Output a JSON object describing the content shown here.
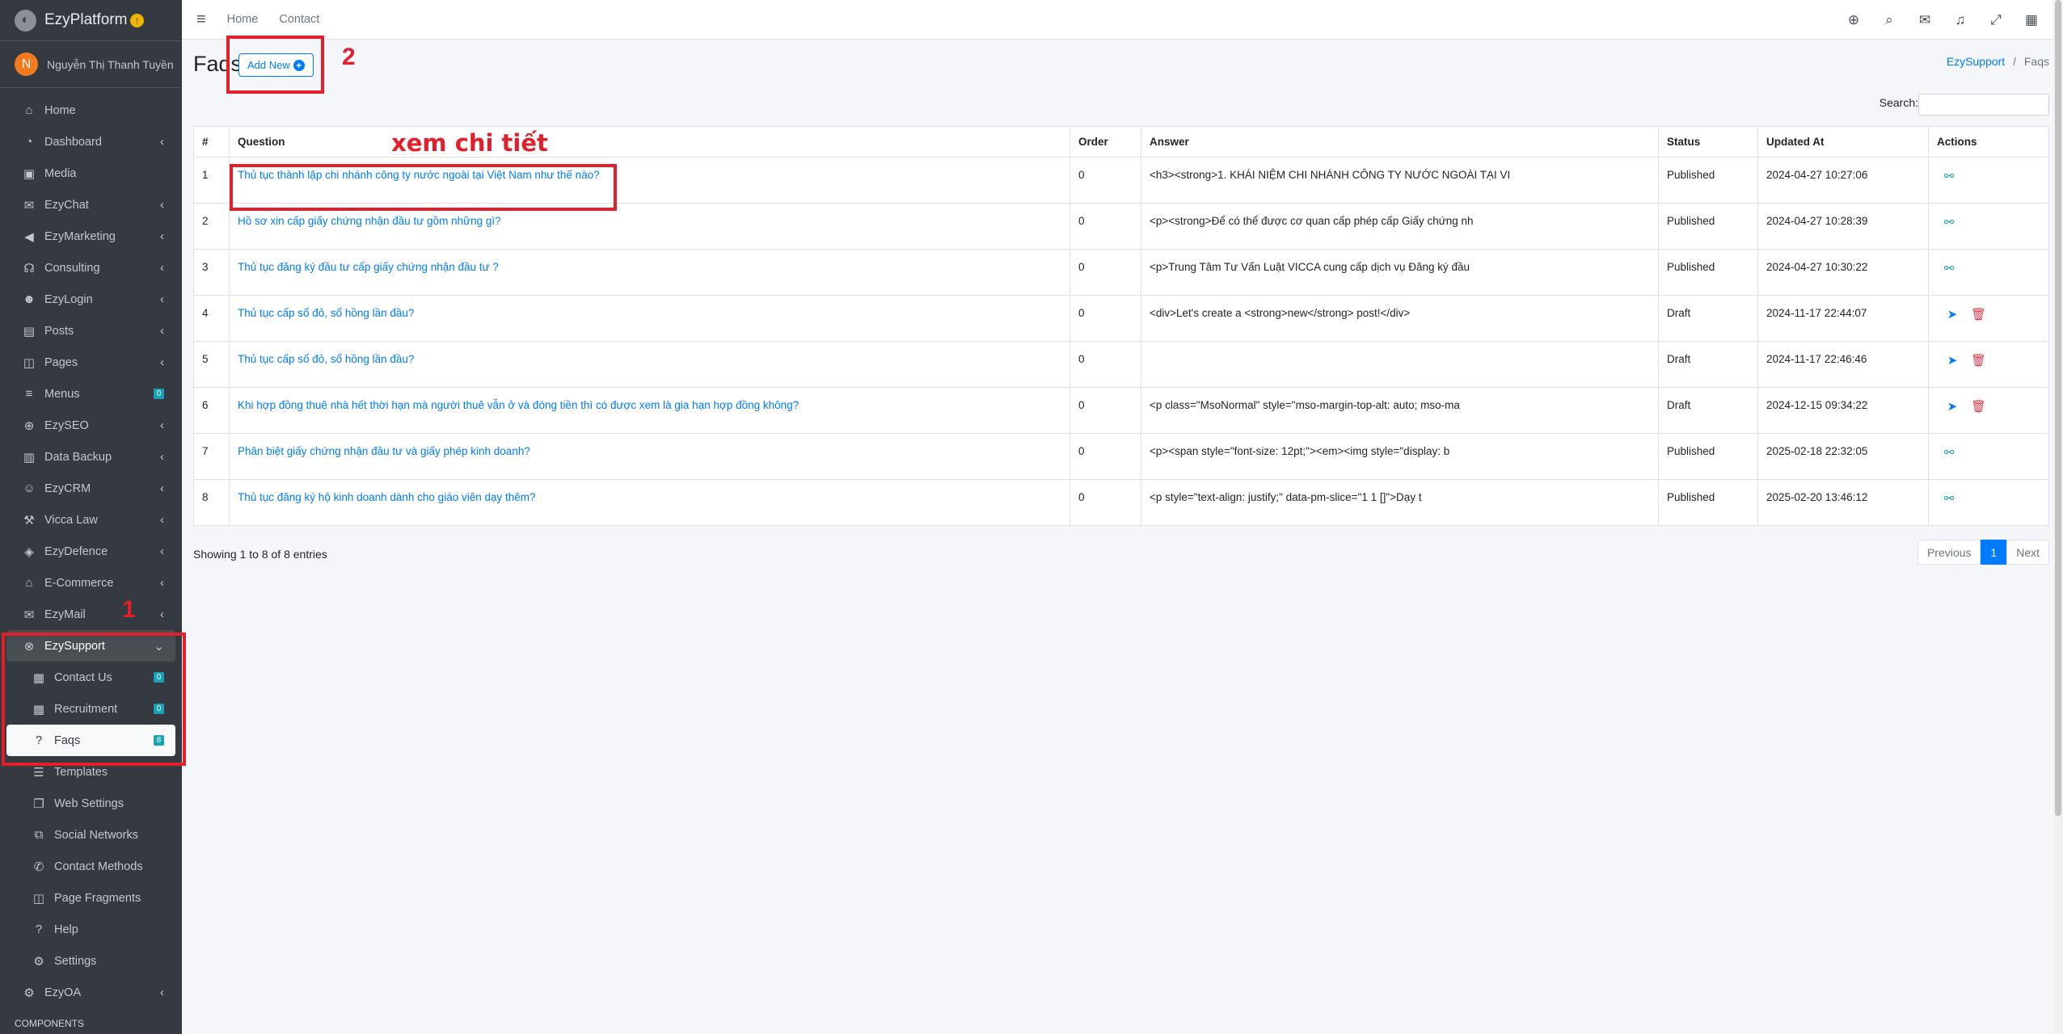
{
  "brand": {
    "name": "EzyPlatform",
    "up_icon": "arrow-up-circle-icon"
  },
  "user": {
    "initial": "N",
    "name": "Nguyễn Thị Thanh Tuyền"
  },
  "sidebar": {
    "items": [
      {
        "label": "Home",
        "icon": "home-icon",
        "arrow": false
      },
      {
        "label": "Dashboard",
        "icon": "dashboard-icon",
        "arrow": true
      },
      {
        "label": "Media",
        "icon": "image-icon",
        "arrow": false
      },
      {
        "label": "EzyChat",
        "icon": "chat-icon",
        "arrow": true
      },
      {
        "label": "EzyMarketing",
        "icon": "megaphone-icon",
        "arrow": true
      },
      {
        "label": "Consulting",
        "icon": "headset-icon",
        "arrow": true
      },
      {
        "label": "EzyLogin",
        "icon": "user-lock-icon",
        "arrow": true
      },
      {
        "label": "Posts",
        "icon": "newspaper-icon",
        "arrow": true
      },
      {
        "label": "Pages",
        "icon": "columns-icon",
        "arrow": true
      },
      {
        "label": "Menus",
        "icon": "bars-icon",
        "badge": "0"
      },
      {
        "label": "EzySEO",
        "icon": "search-plus-icon",
        "arrow": true
      },
      {
        "label": "Data Backup",
        "icon": "database-icon",
        "arrow": true
      },
      {
        "label": "EzyCRM",
        "icon": "users-cog-icon",
        "arrow": true
      },
      {
        "label": "Vicca Law",
        "icon": "gavel-icon",
        "arrow": true
      },
      {
        "label": "EzyDefence",
        "icon": "shield-icon",
        "arrow": true
      },
      {
        "label": "E-Commerce",
        "icon": "store-icon",
        "arrow": true
      },
      {
        "label": "EzyMail",
        "icon": "envelope-icon",
        "arrow": true
      }
    ],
    "support": {
      "label": "EzySupport",
      "icon": "life-ring-icon"
    },
    "support_sub": [
      {
        "label": "Contact Us",
        "icon": "contact-card-icon",
        "badge": "0"
      },
      {
        "label": "Recruitment",
        "icon": "grid-icon",
        "badge": "0"
      },
      {
        "label": "Faqs",
        "icon": "question-circle-icon",
        "badge": "8",
        "active": true
      }
    ],
    "items_after": [
      {
        "label": "Templates",
        "icon": "table-list-icon"
      },
      {
        "label": "Web Settings",
        "icon": "window-icon"
      },
      {
        "label": "Social Networks",
        "icon": "share-square-icon"
      },
      {
        "label": "Contact Methods",
        "icon": "phone-icon"
      },
      {
        "label": "Page Fragments",
        "icon": "columns-icon"
      },
      {
        "label": "Help",
        "icon": "help-circle-icon"
      },
      {
        "label": "Settings",
        "icon": "cogs-icon"
      }
    ],
    "ezyoa": {
      "label": "EzyOA",
      "icon": "cog-icon"
    },
    "components_header": "COMPONENTS"
  },
  "topbar": {
    "links": [
      "Home",
      "Contact"
    ],
    "icons": [
      "globe-icon",
      "search-icon",
      "comments-icon",
      "bell-icon",
      "expand-icon",
      "apps-grid-icon"
    ]
  },
  "page": {
    "title": "Faqs",
    "add_new_label": "Add New",
    "breadcrumb": {
      "parent": "EzySupport",
      "separator": "/",
      "current": "Faqs"
    },
    "search_label": "Search:"
  },
  "table": {
    "headers": [
      "#",
      "Question",
      "Order",
      "Answer",
      "Status",
      "Updated At",
      "Actions"
    ],
    "rows": [
      {
        "n": "1",
        "question": "Thủ tục thành lập chi nhánh công ty nước ngoài tại Việt Nam như thế nào?",
        "order": "0",
        "answer": "<h3><strong>1. KHÁI NIỆM CHI NHÁNH CÔNG TY NƯỚC NGOÀI TẠI VI",
        "status": "Published",
        "updated": "2024-04-27 10:27:06",
        "actions": [
          "unlink"
        ]
      },
      {
        "n": "2",
        "question": "Hồ sơ xin cấp giấy chứng nhận đầu tư gồm những gì?",
        "order": "0",
        "answer": "<p><strong>Để có thể được cơ quan cấp phép cấp Giấy chứng nh",
        "status": "Published",
        "updated": "2024-04-27 10:28:39",
        "actions": [
          "unlink"
        ]
      },
      {
        "n": "3",
        "question": "Thủ tục đăng ký đầu tư cấp giấy chứng nhận đầu tư ?",
        "order": "0",
        "answer": "<p>Trung Tâm Tư Vấn Luật VICCA  cung cấp dịch vụ Đăng ký đầu",
        "status": "Published",
        "updated": "2024-04-27 10:30:22",
        "actions": [
          "unlink"
        ]
      },
      {
        "n": "4",
        "question": "Thủ tục cấp sổ đỏ, sổ hồng lần đầu?",
        "order": "0",
        "answer": "<div>Let's create a <strong>new</strong> post!</div>",
        "status": "Draft",
        "updated": "2024-11-17 22:44:07",
        "actions": [
          "send",
          "delete"
        ]
      },
      {
        "n": "5",
        "question": "Thủ tục cấp sổ đỏ, sổ hồng lần đầu?",
        "order": "0",
        "answer": "",
        "status": "Draft",
        "updated": "2024-11-17 22:46:46",
        "actions": [
          "send",
          "delete"
        ]
      },
      {
        "n": "6",
        "question": "Khi hợp đồng thuê nhà hết thời hạn mà người thuê vẫn ở và đóng tiền thì có được xem là gia hạn hợp đồng không?",
        "order": "0",
        "answer": "<p class=\"MsoNormal\" style=\"mso-margin-top-alt: auto; mso-ma",
        "status": "Draft",
        "updated": "2024-12-15 09:34:22",
        "actions": [
          "send",
          "delete"
        ]
      },
      {
        "n": "7",
        "question": "Phân biệt giấy chứng nhận đầu tư và giấy phép kinh doanh?",
        "order": "0",
        "answer": "<p><span style=\"font-size: 12pt;\"><em><img style=\"display: b",
        "status": "Published",
        "updated": "2025-02-18 22:32:05",
        "actions": [
          "unlink"
        ]
      },
      {
        "n": "8",
        "question": "Thủ tục đăng ký hộ kinh doanh dành cho giáo viên dạy thêm?",
        "order": "0",
        "answer": "<p style=\"text-align: justify;\" data-pm-slice=\"1 1 []\">Dạy t",
        "status": "Published",
        "updated": "2025-02-20 13:46:12",
        "actions": [
          "unlink"
        ]
      }
    ]
  },
  "footer": {
    "showing": "Showing 1 to 8 of 8 entries",
    "pager": {
      "previous": "Previous",
      "current": "1",
      "next": "Next"
    }
  },
  "annotations": {
    "marker_1": "1",
    "marker_2": "2",
    "detail_note": "xem chi tiết",
    "color": "#e2202c"
  }
}
